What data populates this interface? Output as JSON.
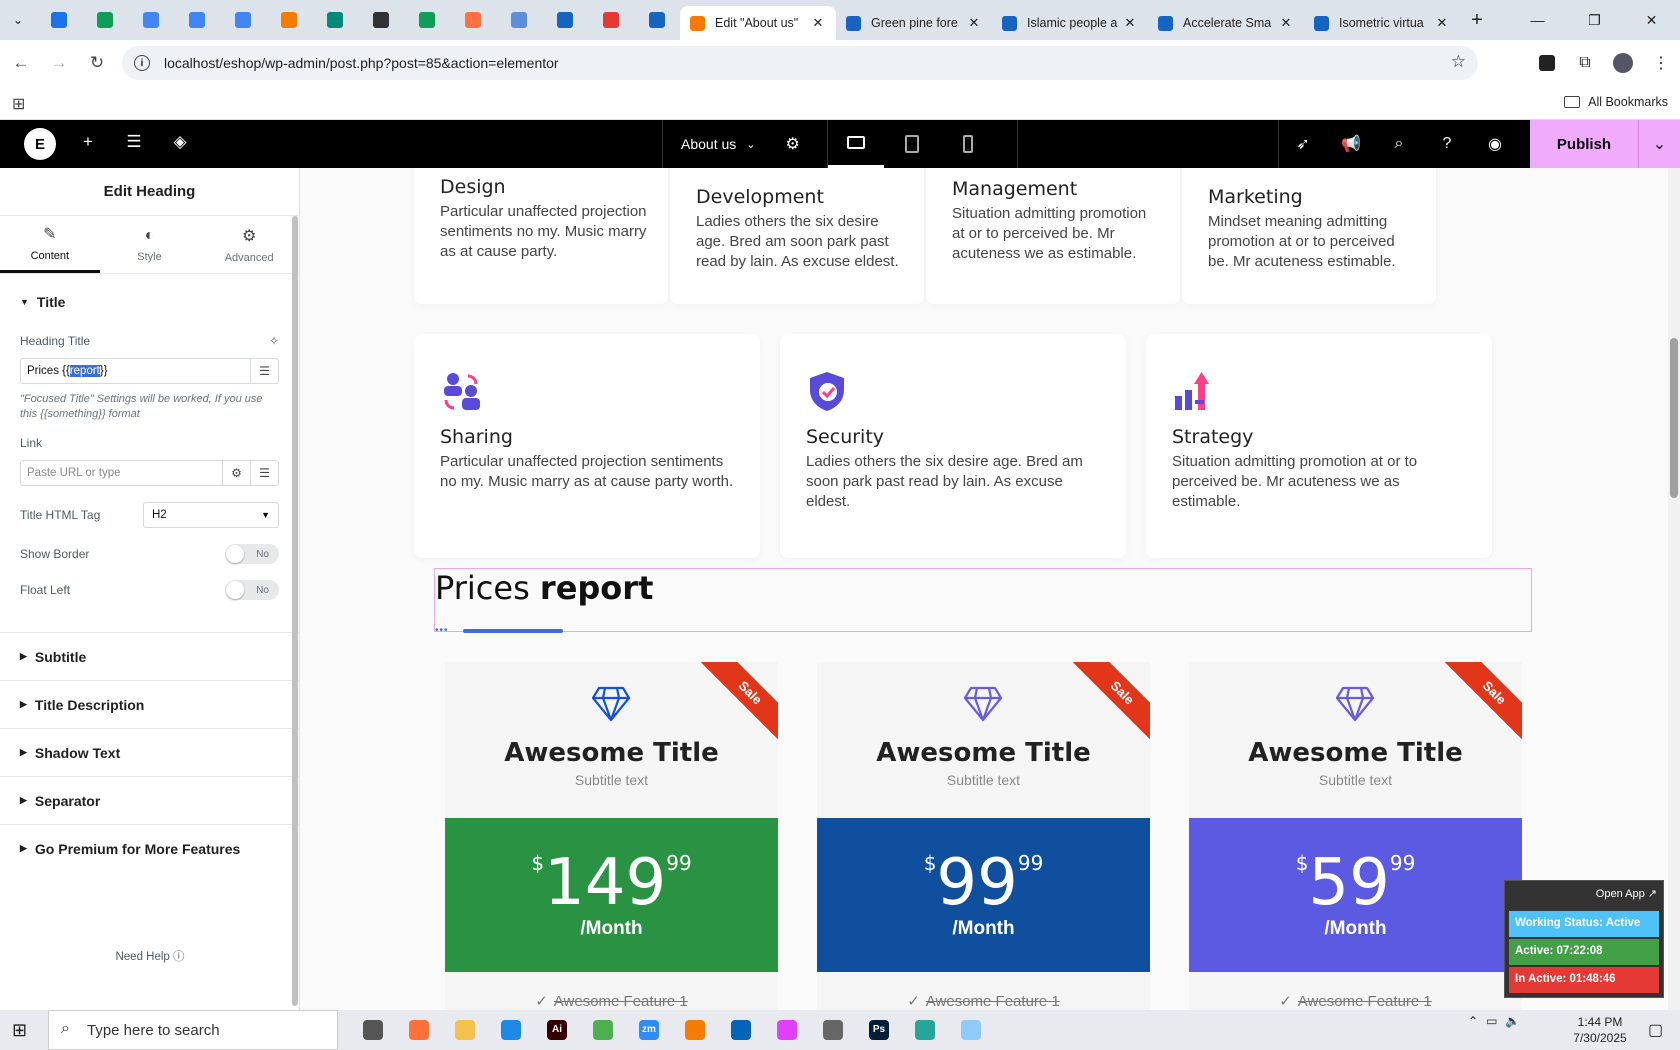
{
  "browser": {
    "pinned_colors": [
      "#1a73e8",
      "#0f9d58",
      "#4285f4",
      "#4285f4",
      "#4285f4",
      "#f57c00",
      "#00897b",
      "#333333",
      "#0f9d58",
      "#ff7043",
      "#5b8fdc",
      "#1565c0",
      "#e53935",
      "#1565c0"
    ],
    "tabs": [
      {
        "title": "Edit \"About us\"",
        "color": "#f57c00",
        "active": true
      },
      {
        "title": "Green pine fore",
        "color": "#1565c0",
        "active": false
      },
      {
        "title": "Islamic people a",
        "color": "#1565c0",
        "active": false
      },
      {
        "title": "Accelerate Sma",
        "color": "#1565c0",
        "active": false
      },
      {
        "title": "Isometric virtua",
        "color": "#1565c0",
        "active": false
      }
    ],
    "url": "localhost/eshop/wp-admin/post.php?post=85&action=elementor",
    "all_bookmarks": "All Bookmarks"
  },
  "elementor": {
    "document": "About us",
    "publish": "Publish"
  },
  "panel": {
    "title": "Edit Heading",
    "tabs": [
      "Content",
      "Style",
      "Advanced"
    ],
    "section_title": "Title",
    "heading_title_label": "Heading Title",
    "heading_value_before": "Prices {{",
    "heading_value_selected": "report",
    "heading_value_after": "}}",
    "hint": "\"Focused Title\" Settings will be worked, If you use this {{something}} format",
    "link_label": "Link",
    "link_placeholder": "Paste URL or type",
    "html_tag_label": "Title HTML Tag",
    "html_tag_value": "H2",
    "show_border_label": "Show Border",
    "show_border_value": "No",
    "float_left_label": "Float Left",
    "float_left_value": "No",
    "sections": [
      "Subtitle",
      "Title Description",
      "Shadow Text",
      "Separator",
      "Go Premium for More Features"
    ],
    "need_help": "Need Help"
  },
  "canvas": {
    "services_top": [
      {
        "title": "Design",
        "text": "Particular unaffected projection sentiments no my. Music marry as at cause party."
      },
      {
        "title": "Development",
        "text": "Ladies others the six desire age. Bred am soon park past read by lain. As excuse eldest."
      },
      {
        "title": "Management",
        "text": "Situation admitting promotion at or to perceived be. Mr acuteness we as estimable."
      },
      {
        "title": "Marketing",
        "text": "Mindset meaning admitting promotion at or to perceived be. Mr acuteness estimable."
      }
    ],
    "services_mid": [
      {
        "title": "Sharing",
        "text": "Particular unaffected projection sentiments no my. Music marry as at cause party worth."
      },
      {
        "title": "Security",
        "text": "Ladies others the six desire age. Bred am soon park past read by lain. As excuse eldest."
      },
      {
        "title": "Strategy",
        "text": "Situation admitting promotion at or to perceived be. Mr acuteness we as estimable."
      }
    ],
    "heading_plain": "Prices",
    "heading_bold": "report",
    "prices": [
      {
        "ribbon": "Sale",
        "title": "Awesome Title",
        "subtitle": "Subtitle text",
        "currency": "$",
        "amount": "149",
        "cents": "99",
        "period": "/Month",
        "color": "#2a9343",
        "feature": "Awesome Feature 1"
      },
      {
        "ribbon": "Sale",
        "title": "Awesome Title",
        "subtitle": "Subtitle text",
        "currency": "$",
        "amount": "99",
        "cents": "99",
        "period": "/Month",
        "color": "#0f4f9e",
        "feature": "Awesome Feature 1"
      },
      {
        "ribbon": "Sale",
        "title": "Awesome Title",
        "subtitle": "Subtitle text",
        "currency": "$",
        "amount": "59",
        "cents": "99",
        "period": "/Month",
        "color": "#5b5ae0",
        "feature": "Awesome Feature 1"
      }
    ]
  },
  "widget": {
    "open_app": "Open App ↗",
    "working": "Working Status: Active",
    "active": "Active: 07:22:08",
    "inactive": "In Active: 01:48:46"
  },
  "taskbar": {
    "search_placeholder": "Type here to search",
    "time": "1:44 PM",
    "date": "7/30/2025",
    "apps": [
      {
        "label": "",
        "color": "#555555"
      },
      {
        "label": "",
        "color": "#ff7139"
      },
      {
        "label": "",
        "color": "#f2c14e"
      },
      {
        "label": "",
        "color": "#1e88e5"
      },
      {
        "label": "Ai",
        "color": "#330000"
      },
      {
        "label": "",
        "color": "#4caf50"
      },
      {
        "label": "zm",
        "color": "#2d8cff"
      },
      {
        "label": "",
        "color": "#f57c00"
      },
      {
        "label": "",
        "color": "#0364b8"
      },
      {
        "label": "",
        "color": "#e040fb"
      },
      {
        "label": "",
        "color": "#666666"
      },
      {
        "label": "Ps",
        "color": "#001e36"
      },
      {
        "label": "",
        "color": "#26a69a"
      },
      {
        "label": "",
        "color": "#90caf9"
      }
    ]
  }
}
